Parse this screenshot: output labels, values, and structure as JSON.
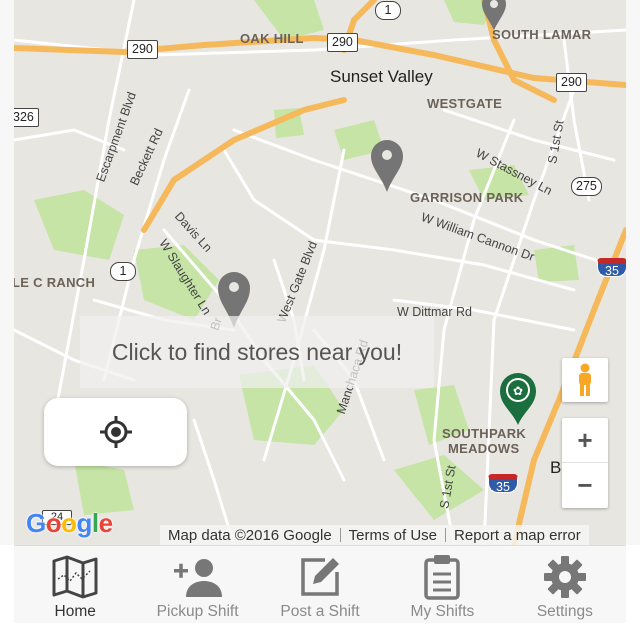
{
  "map": {
    "towns": [
      "Sunset Valley"
    ],
    "places": [
      "OAK HILL",
      "SOUTH LAMAR",
      "WESTGATE",
      "GARRISON PARK",
      "LE C RANCH",
      "SOUTHPARK",
      "MEADOWS"
    ],
    "partial_place": "B",
    "streets": [
      "Escarpment Blvd",
      "Beckett Rd",
      "Davis Ln",
      "W Slaughter Ln",
      "West Gate Blvd",
      "W Stassney Ln",
      "W William Cannon Dr",
      "W Dittmar Rd",
      "Manchaca Rd",
      "S 1st St",
      "S 1st St",
      "Br"
    ],
    "shields": {
      "us290_a": "290",
      "us290_b": "290",
      "us290_c": "290",
      "hwy1_top": "1",
      "hwy1_left": "1",
      "tx275": "275",
      "i35_a": "35",
      "i35_b": "35",
      "route326": "326",
      "route_bottom": "24"
    },
    "find_banner": "Click to find stores near you!",
    "google_logo": [
      "G",
      "o",
      "o",
      "g",
      "l",
      "e"
    ],
    "attribution": {
      "data": "Map data ©2016 Google",
      "terms": "Terms of Use",
      "report": "Report a map error"
    },
    "zoom": {
      "in": "+",
      "out": "−"
    },
    "colors": {
      "land": "#e8e6e1",
      "park": "#c5e4a5",
      "highway": "#f5b95b",
      "road": "#ffffff",
      "pin": "#757575",
      "store_pin": "#1b6e3d"
    }
  },
  "tabs": [
    {
      "label": "Home",
      "icon": "map-icon",
      "active": true
    },
    {
      "label": "Pickup Shift",
      "icon": "add-person-icon",
      "active": false
    },
    {
      "label": "Post a Shift",
      "icon": "edit-icon",
      "active": false
    },
    {
      "label": "My Shifts",
      "icon": "clipboard-icon",
      "active": false
    },
    {
      "label": "Settings",
      "icon": "gear-icon",
      "active": false
    }
  ]
}
